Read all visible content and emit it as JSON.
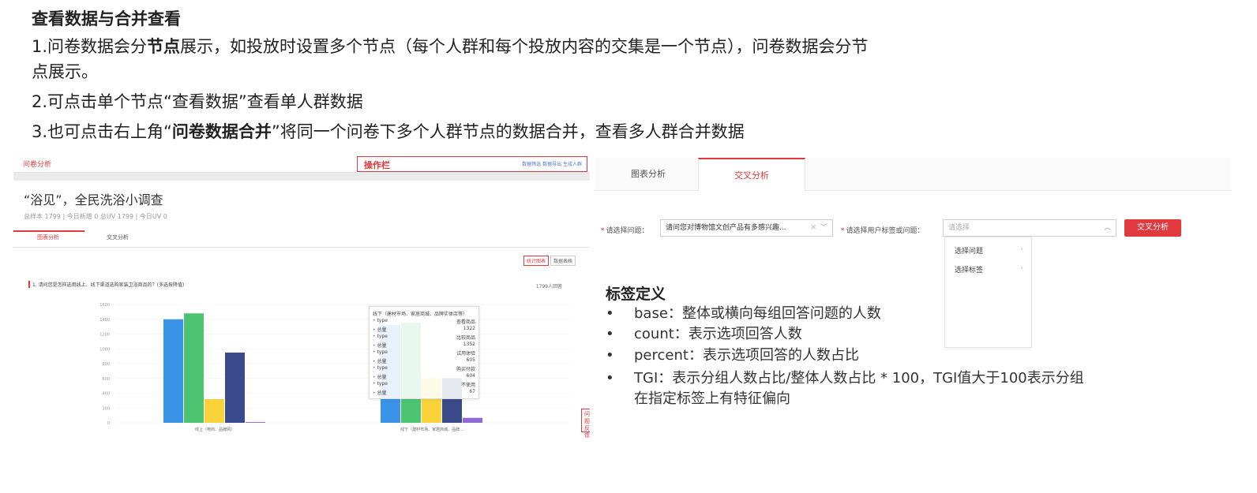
{
  "doc": {
    "title": "查看数据与合并查看",
    "line1_pre": "1.问卷数据会分",
    "line1_bold": "节点",
    "line1_post": "展示，如投放时设置多个节点（每个人群和每个投放内容的交集是一个节点），问卷数据会分节",
    "line1_cont": "点展示。",
    "line2": "2.可点击单个节点“查看数据”查看单人群数据",
    "line3_pre": "3.也可点击右上角“",
    "line3_bold": "问卷数据合并",
    "line3_post": "”将同一个问卷下多个人群节点的数据合并，查看多人群合并数据"
  },
  "left": {
    "brand": "问卷分析",
    "ops_label": "操作栏",
    "ops_links": "数据筛选  数据导出  生成人群",
    "survey_title": "“浴见”，全民洗浴小调查",
    "stats": "总样本 1799 | 今日新增 0    总UV 1799 | 今日UV 0",
    "tabs": [
      "图表分析",
      "交叉分析"
    ],
    "btn_chart": "统计图表",
    "btn_table": "数据表格",
    "question": "1. 请问您是怎样选用线上、线下渠道选购家装卫浴商品的？(多选按降值)",
    "respondents": "1799人回答",
    "side_button": "问题反馈",
    "tooltip": {
      "title": "线下（建材市场、家居商城、品牌实体店等）",
      "rows": [
        {
          "k": "type",
          "v": "查看商品"
        },
        {
          "k": "总量",
          "v": "1322"
        },
        {
          "k": "type",
          "v": "比较商品"
        },
        {
          "k": "总量",
          "v": "1352"
        },
        {
          "k": "type",
          "v": "试用体验"
        },
        {
          "k": "总量",
          "v": "605"
        },
        {
          "k": "type",
          "v": "购买付款"
        },
        {
          "k": "总量",
          "v": "604"
        },
        {
          "k": "type",
          "v": "不使用"
        },
        {
          "k": "总量",
          "v": "67"
        }
      ]
    }
  },
  "chart_data": {
    "type": "bar",
    "categories": [
      "线上（电商、品牌网）",
      "线下（建材市场、家居商城、品牌..."
    ],
    "series": [
      {
        "name": "查看商品",
        "color": "#3b93e8",
        "values": [
          1400,
          1322
        ]
      },
      {
        "name": "比较商品",
        "color": "#4cc470",
        "values": [
          1480,
          1352
        ]
      },
      {
        "name": "试用体验",
        "color": "#fbd23a",
        "values": [
          320,
          605
        ]
      },
      {
        "name": "购买付款",
        "color": "#3a4a8a",
        "values": [
          950,
          604
        ]
      },
      {
        "name": "不使用",
        "color": "#9467d6",
        "values": [
          10,
          67
        ]
      }
    ],
    "y_ticks": [
      "0",
      "200",
      "400",
      "600",
      "800",
      "1000",
      "1200",
      "1400",
      "1600"
    ],
    "ylim": [
      0,
      1600
    ]
  },
  "right": {
    "tabs": [
      "图表分析",
      "交叉分析"
    ],
    "label_q": "请选择问题：",
    "select_q_value": "请问您对博物馆文创产品有多感兴趣...",
    "label_tag": "请选择用户标签或问题：",
    "select_tag_placeholder": "请选择",
    "button": "交叉分析",
    "dropdown": [
      "选择问题",
      "选择标签"
    ],
    "def_title": "标签定义",
    "bullets": [
      "base：整体或横向每组回答问题的人数",
      "count：表示选项回答人数",
      "percent：表示选项回答的人数占比",
      "TGI：表示分组人数占比/整体人数占比 * 100，TGI值大于100表示分组"
    ],
    "bullet_cont": "在指定标签上有特征偏向",
    "bullet_symbol": "•",
    "icons": {
      "caret": "chevron-down-icon",
      "clear": "close-icon",
      "arrow": "chevron-right-icon"
    }
  }
}
